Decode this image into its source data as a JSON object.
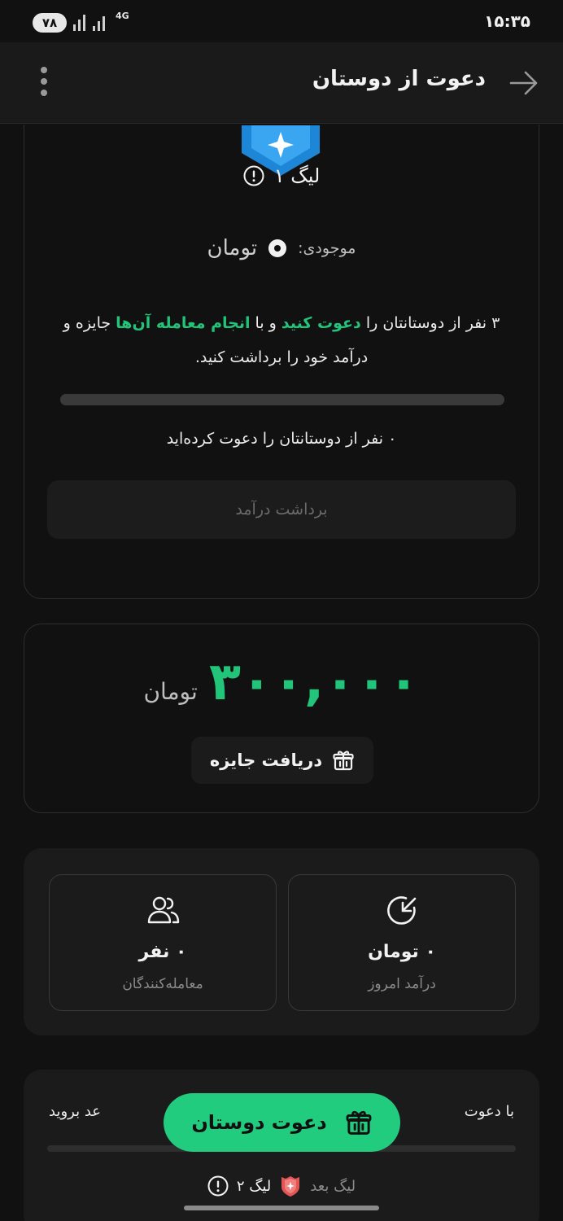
{
  "status_bar": {
    "battery": "۷۸",
    "network": "4G",
    "time": "۱۵:۳۵"
  },
  "header": {
    "title": "دعوت از دوستان"
  },
  "league": {
    "name": "لیگ ۱",
    "balance_label": "موجودی:",
    "balance_unit": "تومان",
    "desc_part1": "۳ نفر از دوستانتان را ",
    "desc_link1": "دعوت کنید",
    "desc_part2": " و با ",
    "desc_link2": "انجام معامله آن‌ها",
    "desc_part3": " جایزه و درآمد خود را برداشت کنید.",
    "progress_fraction": 0,
    "invited_text": "۰ نفر از دوستانتان را دعوت کرده‌اید",
    "withdraw_button": "برداشت درآمد"
  },
  "reward": {
    "amount": "۳۰۰,۰۰۰",
    "unit": "تومان",
    "receive_button": "دریافت جایزه"
  },
  "stats": {
    "today_income_value": "۰ تومان",
    "today_income_label": "درآمد امروز",
    "traders_value": "۰ نفر",
    "traders_label": "معامله‌کنندگان"
  },
  "next_league": {
    "text_start": "با دعوت",
    "text_end": "عد بروید",
    "label": "لیگ بعد",
    "name": "لیگ ۲"
  },
  "fab": {
    "label": "دعوت دوستان"
  },
  "colors": {
    "accent": "#22c47a",
    "background": "#111111",
    "card": "#1b1b1b"
  }
}
